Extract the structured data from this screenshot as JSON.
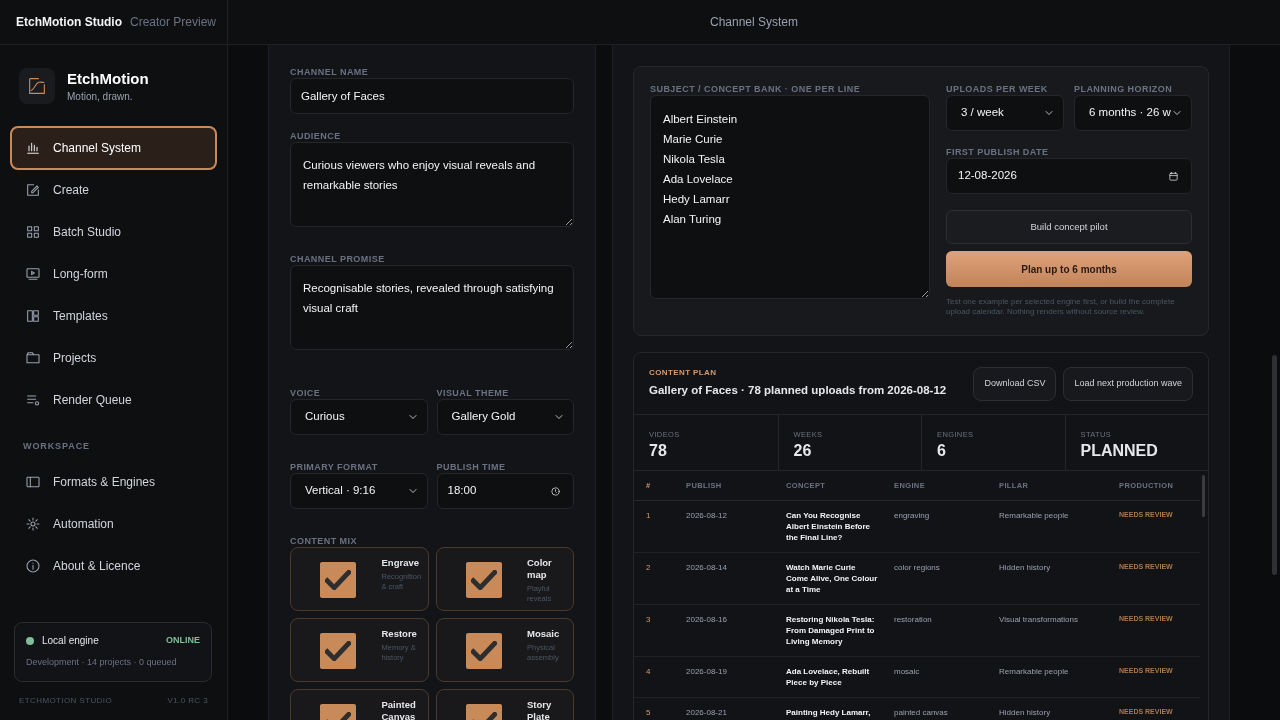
{
  "app": {
    "name": "EtchMotion Studio",
    "edition": "Creator Preview"
  },
  "header_title": "Channel System",
  "brand": {
    "name": "EtchMotion",
    "tagline": "Motion, drawn."
  },
  "nav": [
    {
      "label": "Channel System",
      "selected": true
    },
    {
      "label": "Create",
      "selected": false
    },
    {
      "label": "Batch Studio",
      "selected": false
    },
    {
      "label": "Long-form",
      "selected": false
    },
    {
      "label": "Templates",
      "selected": false
    },
    {
      "label": "Projects",
      "selected": false
    },
    {
      "label": "Render Queue",
      "selected": false
    }
  ],
  "workspace": {
    "heading": "WORKSPACE",
    "items": [
      {
        "label": "Formats & Engines",
        "selected": false
      },
      {
        "label": "Automation",
        "selected": false
      },
      {
        "label": "About & Licence",
        "selected": false
      }
    ]
  },
  "engine": {
    "label": "Local engine",
    "status": "ONLINE",
    "online": true,
    "detail": "Development · 14 projects · 0 queued"
  },
  "footer": {
    "left": "ETCHMOTION STUDIO",
    "right": "V1.0 RC 3"
  },
  "form": {
    "channel_name": {
      "label": "CHANNEL NAME",
      "value": "Gallery of Faces"
    },
    "audience": {
      "label": "AUDIENCE",
      "value": "Curious viewers who enjoy visual reveals and remarkable stories"
    },
    "promise": {
      "label": "CHANNEL PROMISE",
      "value": "Recognisable stories, revealed through satisfying visual craft"
    },
    "voice": {
      "label": "VOICE",
      "value": "Curious"
    },
    "visual_theme": {
      "label": "VISUAL THEME",
      "value": "Gallery Gold"
    },
    "primary_format": {
      "label": "PRIMARY FORMAT",
      "value": "Vertical · 9:16"
    },
    "publish_time": {
      "label": "PUBLISH TIME",
      "value": "18:00"
    },
    "content_mix": {
      "label": "CONTENT MIX",
      "items": [
        {
          "title": "Engrave",
          "subtitle": "Recognition & craft",
          "checked": true
        },
        {
          "title": "Color map",
          "subtitle": "Playful reveals",
          "checked": true
        },
        {
          "title": "Restore",
          "subtitle": "Memory & history",
          "checked": true
        },
        {
          "title": "Mosaic",
          "subtitle": "Physical assembly",
          "checked": true
        },
        {
          "title": "Painted Canvas",
          "checked": true
        },
        {
          "title": "Story Plate",
          "checked": true
        }
      ]
    }
  },
  "planner": {
    "concept_bank": {
      "label": "SUBJECT / CONCEPT BANK · ONE PER LINE",
      "lines": [
        "Albert Einstein",
        "Marie Curie",
        "Nikola Tesla",
        "Ada Lovelace",
        "Hedy Lamarr",
        "Alan Turing"
      ]
    },
    "uploads_per_week": {
      "label": "UPLOADS PER WEEK",
      "value": "3 / week"
    },
    "planning_horizon": {
      "label": "PLANNING HORIZON",
      "value": "6 months · 26 w"
    },
    "first_publish_date": {
      "label": "FIRST PUBLISH DATE",
      "value": "12-08-2026"
    },
    "pilot_button": "Build concept pilot",
    "plan_button": "Plan up to 6 months",
    "note": "Test one example per selected engine first, or build the complete upload calendar. Nothing renders without source review."
  },
  "plan": {
    "eyebrow": "CONTENT PLAN",
    "title": "Gallery of Faces · 78 planned uploads from 2026-08-12",
    "buttons": [
      "Download CSV",
      "Load next production wave"
    ],
    "stats": [
      {
        "label": "VIDEOS",
        "value": "78"
      },
      {
        "label": "WEEKS",
        "value": "26"
      },
      {
        "label": "ENGINES",
        "value": "6"
      },
      {
        "label": "STATUS",
        "value": "PLANNED"
      }
    ],
    "table": {
      "columns": [
        "#",
        "PUBLISH",
        "CONCEPT",
        "ENGINE",
        "PILLAR",
        "PRODUCTION"
      ],
      "rows": [
        {
          "num": "1",
          "publish": "2026-08-12",
          "concept": "Can You Recognise Albert Einstein Before the Final Line?",
          "engine": "engraving",
          "pillar": "Remarkable people",
          "production": "NEEDS REVIEW"
        },
        {
          "num": "2",
          "publish": "2026-08-14",
          "concept": "Watch Marie Curie Come Alive, One Colour at a Time",
          "engine": "color regions",
          "pillar": "Hidden history",
          "production": "NEEDS REVIEW"
        },
        {
          "num": "3",
          "publish": "2026-08-16",
          "concept": "Restoring Nikola Tesla: From Damaged Print to Living Memory",
          "engine": "restoration",
          "pillar": "Visual transformations",
          "production": "NEEDS REVIEW"
        },
        {
          "num": "4",
          "publish": "2026-08-19",
          "concept": "Ada Lovelace, Rebuilt Piece by Piece",
          "engine": "mosaic",
          "pillar": "Remarkable people",
          "production": "NEEDS REVIEW"
        },
        {
          "num": "5",
          "publish": "2026-08-21",
          "concept": "Painting Hedy Lamarr,",
          "engine": "painted canvas",
          "pillar": "Hidden history",
          "production": "NEEDS REVIEW"
        }
      ]
    }
  }
}
